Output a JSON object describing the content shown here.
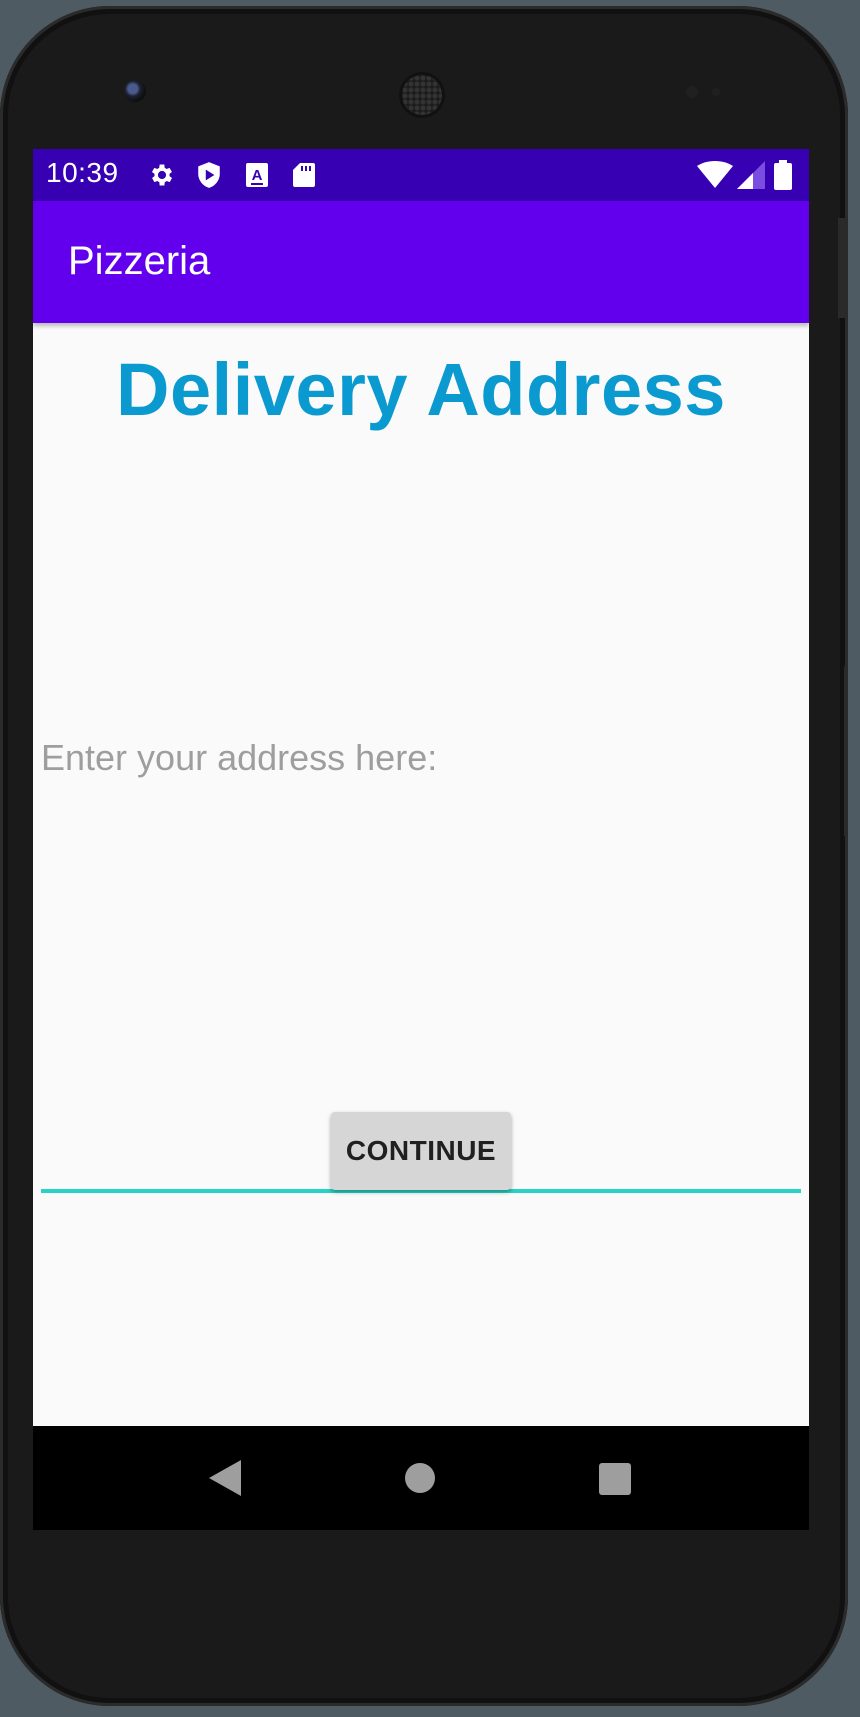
{
  "status_bar": {
    "time": "10:39",
    "left_icons": [
      "settings-icon",
      "shield-play-icon",
      "font-a-icon",
      "sd-card-icon"
    ],
    "right_icons": [
      "wifi-icon",
      "cell-signal-icon",
      "battery-icon"
    ],
    "background": "#3700b3"
  },
  "app_bar": {
    "title": "Pizzeria",
    "background": "#6200ee"
  },
  "main": {
    "heading": "Delivery Address",
    "heading_color": "#0a9ad0",
    "address_input": {
      "value": "",
      "placeholder": "Enter your address here:",
      "underline_color": "#26d3c6"
    },
    "continue_button": {
      "label": "CONTINUE"
    }
  },
  "nav_bar": {
    "buttons": [
      "back-icon",
      "home-icon",
      "recents-icon"
    ]
  }
}
